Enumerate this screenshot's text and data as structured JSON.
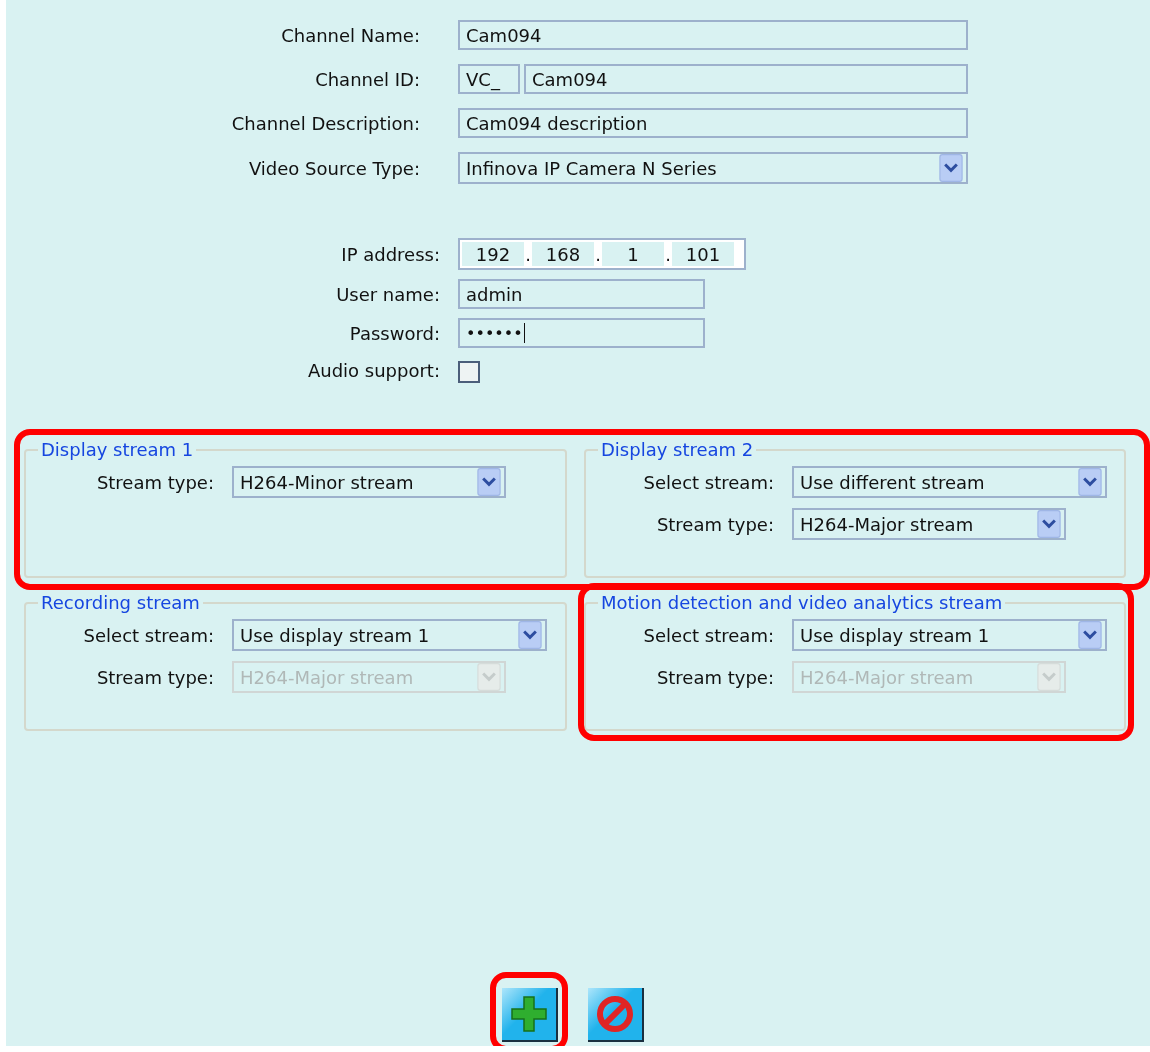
{
  "channel_fields": [
    {
      "kind": "text",
      "label": "Channel Name:",
      "value": "Cam094"
    },
    {
      "kind": "id",
      "label": "Channel ID:",
      "prefix": "VC_",
      "value": "Cam094"
    },
    {
      "kind": "text",
      "label": "Channel Description:",
      "value": "Cam094 description"
    },
    {
      "kind": "select",
      "label": "Video Source Type:",
      "value": "Infinova IP Camera N Series"
    }
  ],
  "connection_fields": [
    {
      "kind": "ip",
      "label": "IP address:",
      "octets": [
        "192",
        "168",
        "1",
        "101"
      ],
      "separator": "."
    },
    {
      "kind": "short",
      "label": "User name:",
      "value": "admin"
    },
    {
      "kind": "password",
      "label": "Password:",
      "value": "••••••"
    },
    {
      "kind": "checkbox",
      "label": "Audio support:",
      "checked": false
    }
  ],
  "stream_rows": [
    {
      "highlighted": true,
      "groups": [
        {
          "title": "Display stream 1",
          "highlighted": false,
          "rows": [
            {
              "kind": "type",
              "label": "Stream type:",
              "value": "H264-Minor stream",
              "disabled": false
            }
          ]
        },
        {
          "title": "Display stream 2",
          "highlighted": false,
          "rows": [
            {
              "kind": "source",
              "label": "Select stream:",
              "value": "Use different stream",
              "disabled": false
            },
            {
              "kind": "type",
              "label": "Stream type:",
              "value": "H264-Major stream",
              "disabled": false
            }
          ]
        }
      ]
    },
    {
      "highlighted": false,
      "groups": [
        {
          "title": "Recording stream",
          "highlighted": false,
          "rows": [
            {
              "kind": "source",
              "label": "Select stream:",
              "value": "Use display stream 1",
              "disabled": false
            },
            {
              "kind": "type",
              "label": "Stream type:",
              "value": "H264-Major stream",
              "disabled": true
            }
          ]
        },
        {
          "title": "Motion detection and video analytics stream",
          "highlighted": true,
          "rows": [
            {
              "kind": "source",
              "label": "Select stream:",
              "value": "Use display stream 1",
              "disabled": false
            },
            {
              "kind": "type",
              "label": "Stream type:",
              "value": "H264-Major stream",
              "disabled": true
            }
          ]
        }
      ]
    }
  ],
  "buttons": [
    {
      "kind": "add",
      "highlighted": true
    },
    {
      "kind": "cancel",
      "highlighted": false
    }
  ]
}
